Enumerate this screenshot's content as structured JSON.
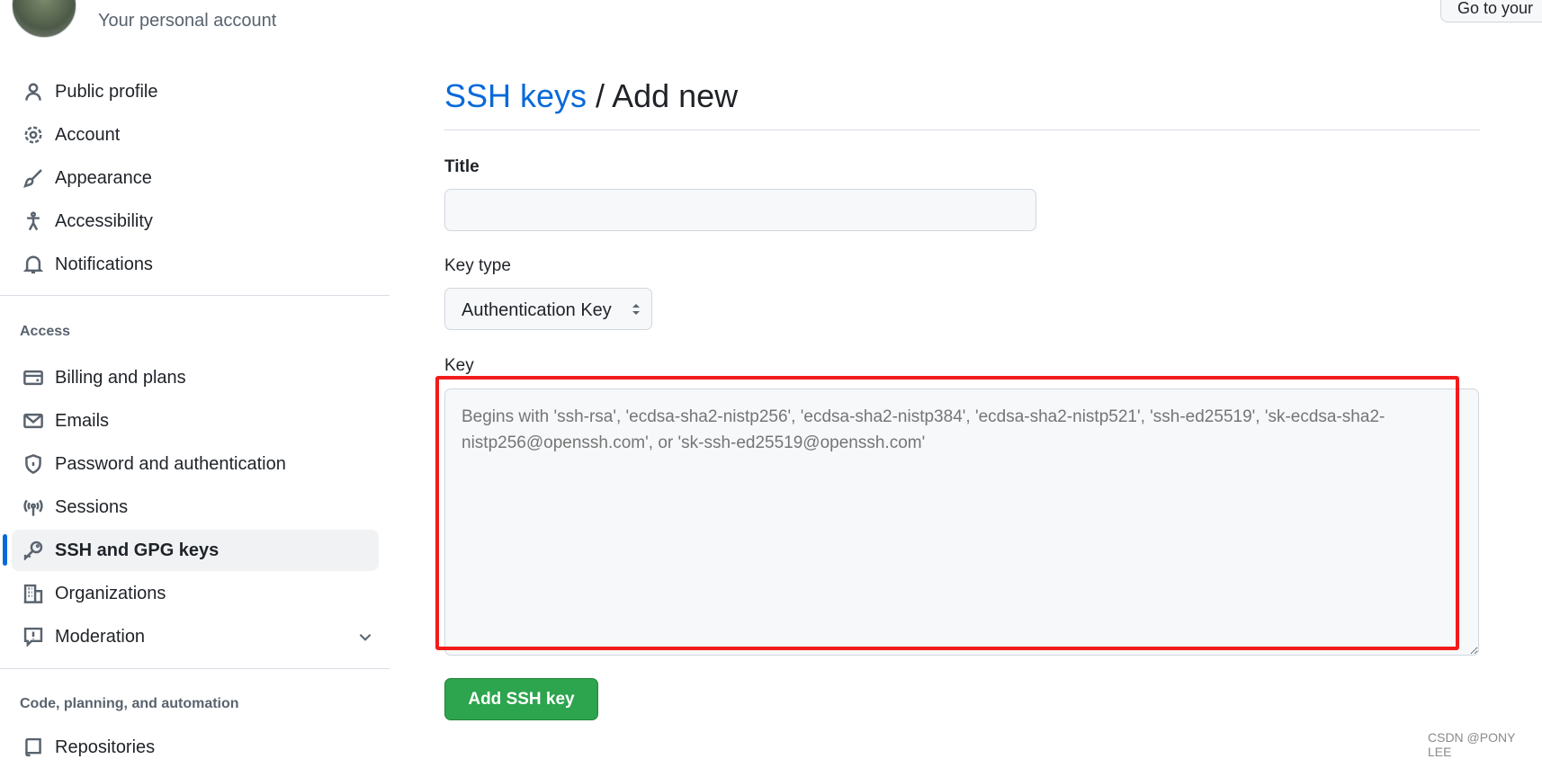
{
  "header": {
    "subtitle": "Your personal account",
    "goto_label": "Go to your"
  },
  "sidebar": {
    "items": [
      {
        "label": "Public profile",
        "icon": "person-icon"
      },
      {
        "label": "Account",
        "icon": "gear-icon"
      },
      {
        "label": "Appearance",
        "icon": "paintbrush-icon"
      },
      {
        "label": "Accessibility",
        "icon": "accessibility-icon"
      },
      {
        "label": "Notifications",
        "icon": "bell-icon"
      }
    ],
    "access_heading": "Access",
    "access_items": [
      {
        "label": "Billing and plans",
        "icon": "credit-card-icon"
      },
      {
        "label": "Emails",
        "icon": "mail-icon"
      },
      {
        "label": "Password and authentication",
        "icon": "shield-lock-icon"
      },
      {
        "label": "Sessions",
        "icon": "broadcast-icon"
      },
      {
        "label": "SSH and GPG keys",
        "icon": "key-icon",
        "selected": true
      },
      {
        "label": "Organizations",
        "icon": "organization-icon"
      },
      {
        "label": "Moderation",
        "icon": "report-icon"
      }
    ],
    "code_heading": "Code, planning, and automation",
    "code_items": [
      {
        "label": "Repositories",
        "icon": "repo-icon"
      }
    ]
  },
  "main": {
    "breadcrumb_link": "SSH keys",
    "breadcrumb_sep": " / ",
    "breadcrumb_current": "Add new",
    "title_label": "Title",
    "title_value": "",
    "key_type_label": "Key type",
    "key_type_value": "Authentication Key",
    "key_label": "Key",
    "key_placeholder": "Begins with 'ssh-rsa', 'ecdsa-sha2-nistp256', 'ecdsa-sha2-nistp384', 'ecdsa-sha2-nistp521', 'ssh-ed25519', 'sk-ecdsa-sha2-nistp256@openssh.com', or 'sk-ssh-ed25519@openssh.com'",
    "submit_label": "Add SSH key"
  },
  "annotation": {
    "highlight_color": "#f21b1b"
  },
  "watermark": "CSDN @PONY LEE",
  "colors": {
    "accent": "#0969da",
    "primary_button": "#2da44e"
  }
}
